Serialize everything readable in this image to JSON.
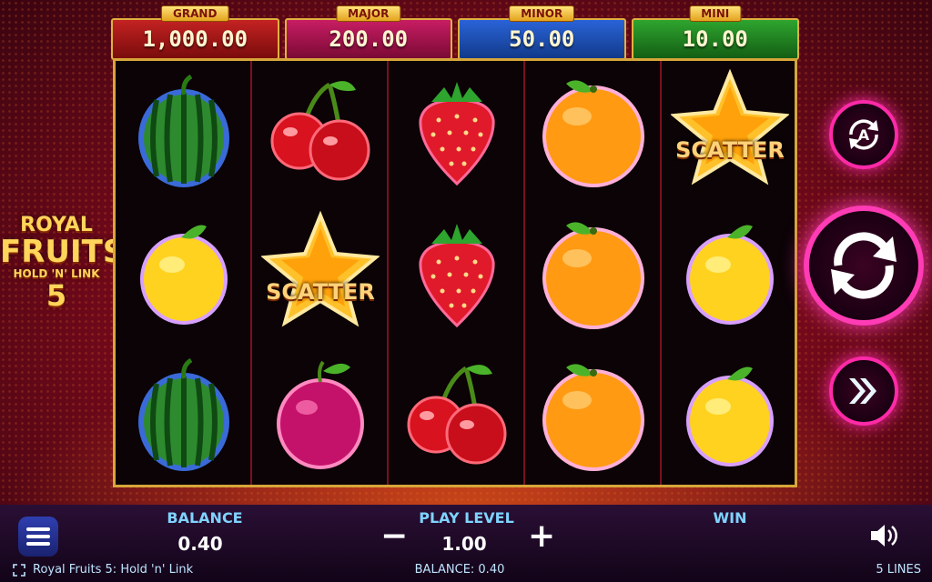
{
  "jackpots": [
    {
      "label": "GRAND",
      "value": "1,000.00",
      "color": "#b01818"
    },
    {
      "label": "MAJOR",
      "value": "200.00",
      "color": "#b01558"
    },
    {
      "label": "MINOR",
      "value": "50.00",
      "color": "#1f4fb8"
    },
    {
      "label": "MINI",
      "value": "10.00",
      "color": "#1f8a22"
    }
  ],
  "logo": {
    "line1": "ROYAL",
    "line2": "FRUITS",
    "line3": "HOLD 'N' LINK",
    "line4": "5"
  },
  "reels": [
    [
      "watermelon",
      "lemon",
      "watermelon"
    ],
    [
      "cherry",
      "scatter",
      "plum"
    ],
    [
      "strawberry",
      "strawberry",
      "cherry"
    ],
    [
      "orange",
      "orange",
      "orange"
    ],
    [
      "scatter",
      "lemon",
      "lemon"
    ]
  ],
  "scatter_text": "SCATTER",
  "bottom": {
    "balance_label": "BALANCE",
    "balance_value": "0.40",
    "play_level_label": "PLAY LEVEL",
    "play_level_value": "1.00",
    "minus": "−",
    "plus": "+",
    "win_label": "WIN"
  },
  "footer": {
    "game_title": "Royal Fruits 5: Hold 'n' Link",
    "balance_text": "BALANCE: 0.40",
    "lines_text": "5 LINES"
  },
  "icons": {
    "autoplay": "autoplay-icon",
    "spin": "spin-icon",
    "turbo": "turbo-icon",
    "menu": "menu-icon",
    "sound": "sound-icon",
    "fullscreen": "fullscreen-icon"
  }
}
